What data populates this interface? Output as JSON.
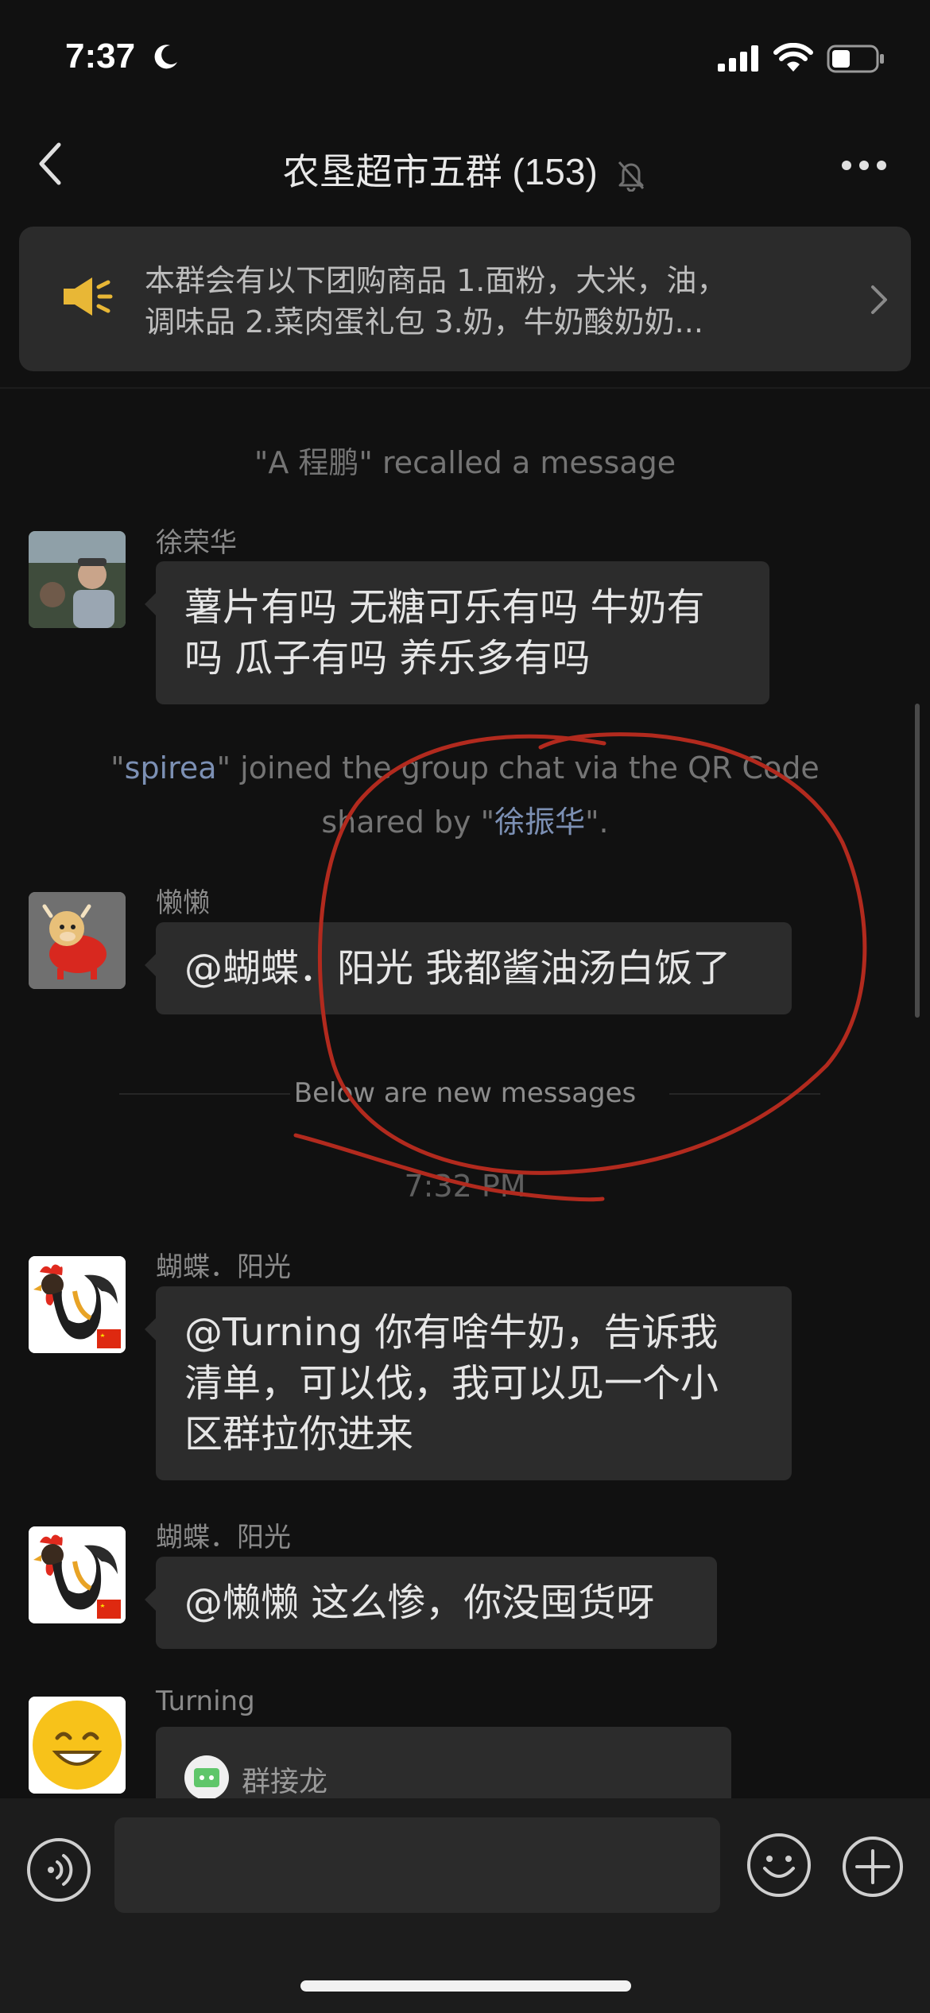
{
  "status_bar": {
    "time": "7:37",
    "icons": [
      "moon-icon",
      "signal-icon",
      "wifi-icon",
      "battery-icon"
    ]
  },
  "nav": {
    "title": "农垦超市五群 (153)",
    "icons": [
      "back-icon",
      "mute-bell-icon",
      "more-icon"
    ]
  },
  "announcement": {
    "line1": "本群会有以下团购商品 1.面粉，大米，油，",
    "line2": "调味品 2.菜肉蛋礼包 3.奶，牛奶酸奶奶..."
  },
  "messages": {
    "recalled": "\"A 程鹏\" recalled a message",
    "msg1": {
      "sender": "徐荣华",
      "line1": "薯片有吗 无糖可乐有吗 牛奶有",
      "line2": "吗 瓜子有吗 养乐多有吗"
    },
    "joined": {
      "q1": "\"",
      "user": "spirea",
      "mid": "\" joined the group chat via the QR Code",
      "shared": "shared by \"",
      "by": "徐振华",
      "end": "\"."
    },
    "msg2": {
      "sender": "懒懒",
      "text": "@蝴蝶．阳光 我都酱油汤白饭了"
    },
    "new_messages": "Below are new messages",
    "timestamp": "7:32 PM",
    "msg3": {
      "sender": "蝴蝶．阳光",
      "line1": "@Turning 你有啥牛奶，告诉我",
      "line2": "清单，可以伐，我可以见一个小",
      "line3": "区群拉你进来"
    },
    "msg4": {
      "sender": "蝴蝶．阳光",
      "text": "@懒懒 这么惨，你没囤货呀"
    },
    "msg5": {
      "sender": "Turning",
      "card_label": "群接龙"
    }
  },
  "input": {
    "value": "",
    "placeholder": ""
  },
  "colors": {
    "background": "#111111",
    "bubble": "#2c2c2c",
    "input_bar": "#1c1c1c",
    "link": "#7c90b4",
    "annotation": "#b22a1e"
  }
}
